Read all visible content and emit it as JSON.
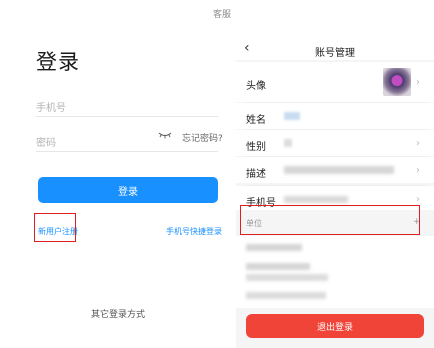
{
  "login": {
    "support": "客服",
    "title": "登录",
    "phone_placeholder": "手机号",
    "password_placeholder": "密码",
    "forgot": "忘记密码?",
    "login_button": "登录",
    "register": "新用户注册",
    "quick_login": "手机号快捷登录",
    "other_methods": "其它登录方式"
  },
  "account": {
    "title": "账号管理",
    "rows": {
      "avatar": "头像",
      "name": "姓名",
      "gender": "性别",
      "description": "描述",
      "phone": "手机号",
      "unit": "单位"
    },
    "logout_button": "退出登录"
  },
  "colors": {
    "accent": "#1890ff",
    "danger": "#f04438",
    "highlight": "#e02020"
  }
}
